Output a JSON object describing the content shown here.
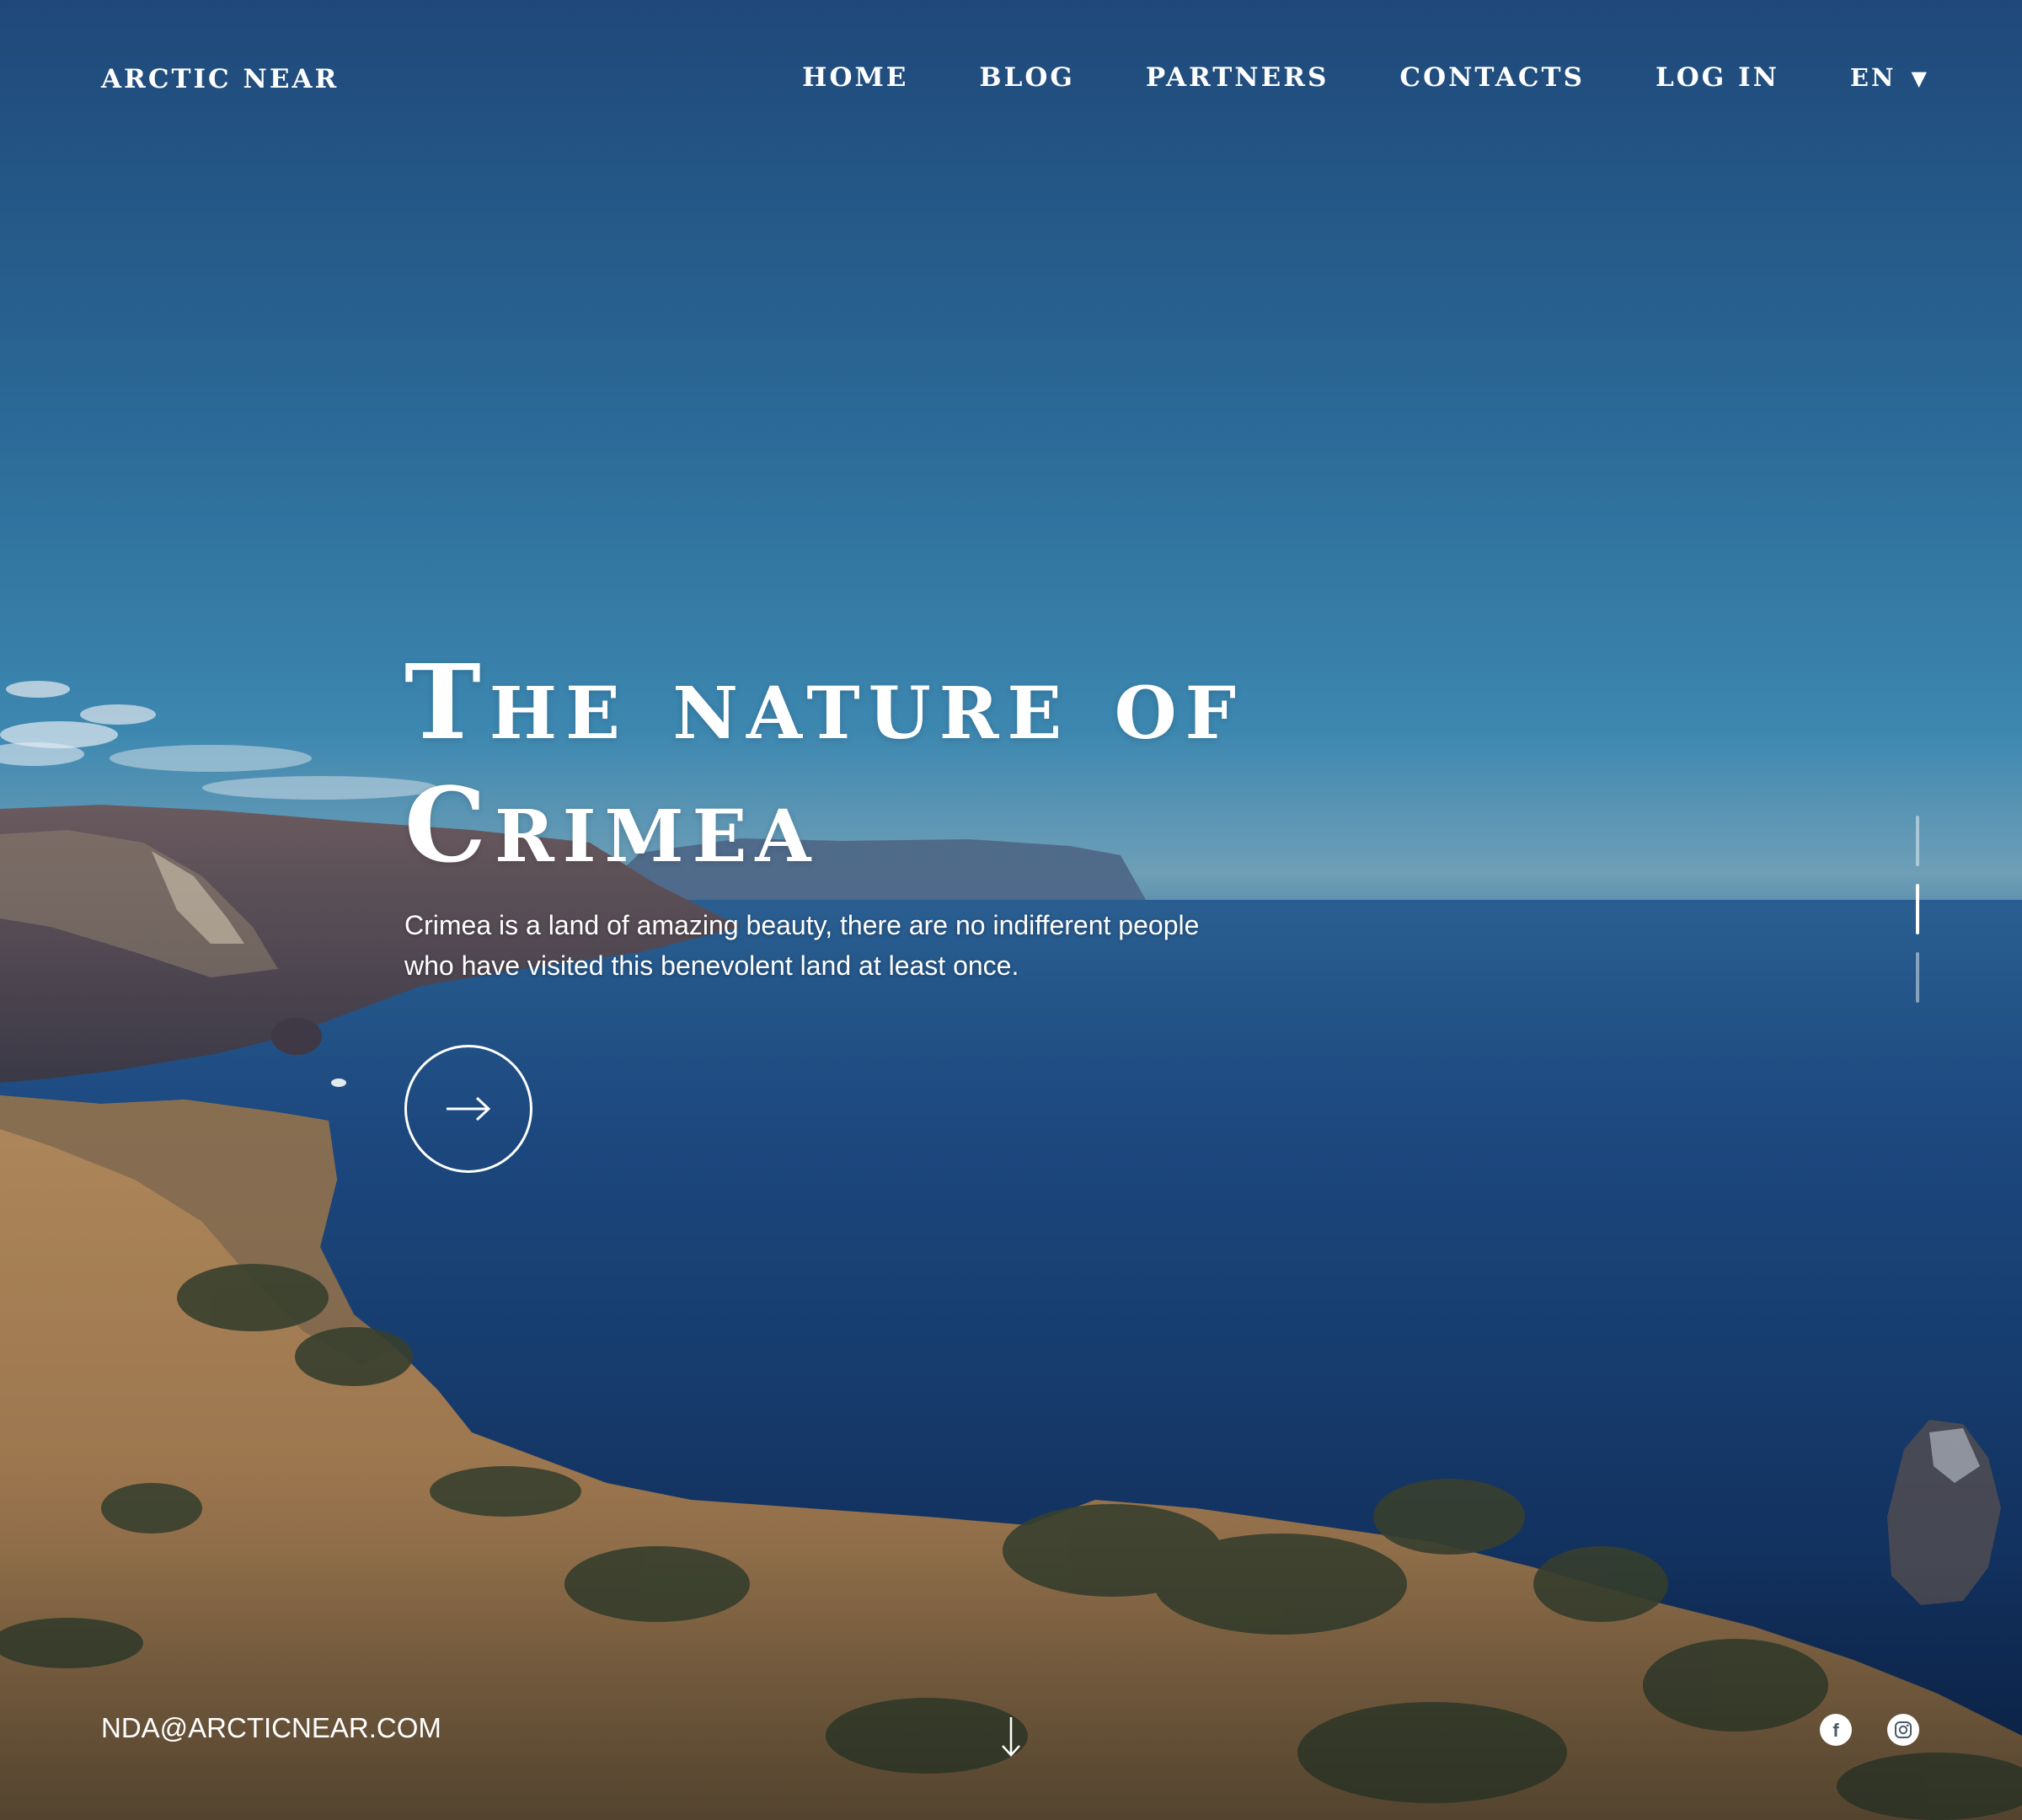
{
  "brand": {
    "logo_text": "ARCTIC NEAR"
  },
  "nav": {
    "items": [
      {
        "label": "HOME"
      },
      {
        "label": "BLOG"
      },
      {
        "label": "PARTNERS"
      },
      {
        "label": "CONTACTS"
      },
      {
        "label": "LOG IN"
      }
    ],
    "language": {
      "current": "EN",
      "caret_icon": "caret-down-icon"
    }
  },
  "hero": {
    "title_line1": "The nature of",
    "title_line2": "Crimea",
    "description": "Crimea is a land of amazing beauty, there are no indifferent people who have visited this benevolent land at least once.",
    "cta_icon": "arrow-right-icon"
  },
  "slider": {
    "count": 3,
    "active_index": 1
  },
  "footer": {
    "email": "NDA@ARCTICNEAR.COM",
    "scroll_icon": "arrow-down-icon",
    "social": [
      {
        "name": "facebook",
        "icon": "facebook-icon"
      },
      {
        "name": "instagram",
        "icon": "instagram-icon"
      }
    ]
  },
  "colors": {
    "sky_top": "#24558e",
    "sea_deep": "#0f2a52",
    "text": "#ffffff",
    "indicator_inactive": "rgba(255,255,255,0.45)"
  }
}
